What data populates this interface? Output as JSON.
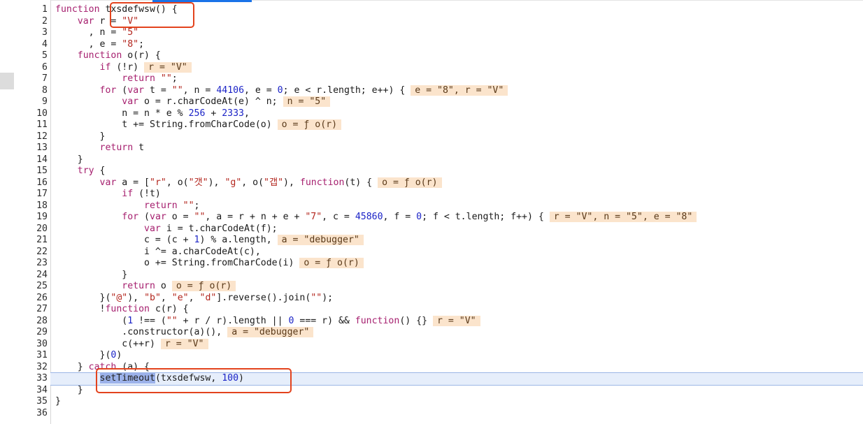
{
  "colors": {
    "keyword": "#a6206f",
    "string": "#b3261e",
    "number": "#1c24c7",
    "inline_value_bg": "#fbe4cc",
    "highlight_line": "#e6eefb",
    "annotation_red": "#e3431d"
  },
  "highlighted_line": 33,
  "lines": [
    {
      "n": "1",
      "t": [
        [
          "kw",
          "function"
        ],
        [
          "fn",
          " "
        ],
        [
          "fn",
          "txsdefwsw"
        ],
        [
          "fn",
          "() {"
        ]
      ]
    },
    {
      "n": "2",
      "t": [
        [
          "fn",
          "    "
        ],
        [
          "kw",
          "var"
        ],
        [
          "fn",
          " r = "
        ],
        [
          "str",
          "\"V\""
        ]
      ]
    },
    {
      "n": "3",
      "t": [
        [
          "fn",
          "      , n = "
        ],
        [
          "str",
          "\"5\""
        ]
      ]
    },
    {
      "n": "4",
      "t": [
        [
          "fn",
          "      , e = "
        ],
        [
          "str",
          "\"8\""
        ],
        [
          "fn",
          ";"
        ]
      ]
    },
    {
      "n": "5",
      "t": [
        [
          "fn",
          "    "
        ],
        [
          "kw",
          "function"
        ],
        [
          "fn",
          " o(r) {"
        ]
      ]
    },
    {
      "n": "6",
      "t": [
        [
          "fn",
          "        "
        ],
        [
          "kw",
          "if"
        ],
        [
          "fn",
          " (!r)"
        ]
      ],
      "p": "r = \"V\""
    },
    {
      "n": "7",
      "t": [
        [
          "fn",
          "            "
        ],
        [
          "kw",
          "return"
        ],
        [
          "fn",
          " "
        ],
        [
          "str",
          "\"\""
        ],
        [
          "fn",
          ";"
        ]
      ]
    },
    {
      "n": "8",
      "t": [
        [
          "fn",
          "        "
        ],
        [
          "kw",
          "for"
        ],
        [
          "fn",
          " ("
        ],
        [
          "kw",
          "var"
        ],
        [
          "fn",
          " t = "
        ],
        [
          "str",
          "\"\""
        ],
        [
          "fn",
          ", n = "
        ],
        [
          "num",
          "44106"
        ],
        [
          "fn",
          ", e = "
        ],
        [
          "num",
          "0"
        ],
        [
          "fn",
          "; e < r.length; e++) {"
        ]
      ],
      "p": "e = \"8\", r = \"V\""
    },
    {
      "n": "9",
      "t": [
        [
          "fn",
          "            "
        ],
        [
          "kw",
          "var"
        ],
        [
          "fn",
          " o = r.charCodeAt(e) ^ n;"
        ]
      ],
      "p": "n = \"5\""
    },
    {
      "n": "10",
      "t": [
        [
          "fn",
          "            n = n * e % "
        ],
        [
          "num",
          "256"
        ],
        [
          "fn",
          " + "
        ],
        [
          "num",
          "2333"
        ],
        [
          "fn",
          ","
        ]
      ]
    },
    {
      "n": "11",
      "t": [
        [
          "fn",
          "            t += String.fromCharCode(o)"
        ]
      ],
      "p": "o = ƒ o(r)"
    },
    {
      "n": "12",
      "t": [
        [
          "fn",
          "        }"
        ]
      ]
    },
    {
      "n": "13",
      "t": [
        [
          "fn",
          "        "
        ],
        [
          "kw",
          "return"
        ],
        [
          "fn",
          " t"
        ]
      ]
    },
    {
      "n": "14",
      "t": [
        [
          "fn",
          "    }"
        ]
      ]
    },
    {
      "n": "15",
      "t": [
        [
          "fn",
          "    "
        ],
        [
          "kw",
          "try"
        ],
        [
          "fn",
          " {"
        ]
      ]
    },
    {
      "n": "16",
      "t": [
        [
          "fn",
          "        "
        ],
        [
          "kw",
          "var"
        ],
        [
          "fn",
          " a = ["
        ],
        [
          "str",
          "\"r\""
        ],
        [
          "fn",
          ", o("
        ],
        [
          "str",
          "\"갯\""
        ],
        [
          "fn",
          "), "
        ],
        [
          "str",
          "\"g\""
        ],
        [
          "fn",
          ", o("
        ],
        [
          "str",
          "\"갭\""
        ],
        [
          "fn",
          "), "
        ],
        [
          "kw",
          "function"
        ],
        [
          "fn",
          "(t) {"
        ]
      ],
      "p": "o = ƒ o(r)"
    },
    {
      "n": "17",
      "t": [
        [
          "fn",
          "            "
        ],
        [
          "kw",
          "if"
        ],
        [
          "fn",
          " (!t)"
        ]
      ]
    },
    {
      "n": "18",
      "t": [
        [
          "fn",
          "                "
        ],
        [
          "kw",
          "return"
        ],
        [
          "fn",
          " "
        ],
        [
          "str",
          "\"\""
        ],
        [
          "fn",
          ";"
        ]
      ]
    },
    {
      "n": "19",
      "t": [
        [
          "fn",
          "            "
        ],
        [
          "kw",
          "for"
        ],
        [
          "fn",
          " ("
        ],
        [
          "kw",
          "var"
        ],
        [
          "fn",
          " o = "
        ],
        [
          "str",
          "\"\""
        ],
        [
          "fn",
          ", a = r + n + e + "
        ],
        [
          "str",
          "\"7\""
        ],
        [
          "fn",
          ", c = "
        ],
        [
          "num",
          "45860"
        ],
        [
          "fn",
          ", f = "
        ],
        [
          "num",
          "0"
        ],
        [
          "fn",
          "; f < t.length; f++) {"
        ]
      ],
      "p": "r = \"V\", n = \"5\", e = \"8\""
    },
    {
      "n": "20",
      "t": [
        [
          "fn",
          "                "
        ],
        [
          "kw",
          "var"
        ],
        [
          "fn",
          " i = t.charCodeAt(f);"
        ]
      ]
    },
    {
      "n": "21",
      "t": [
        [
          "fn",
          "                c = (c + "
        ],
        [
          "num",
          "1"
        ],
        [
          "fn",
          ") % a.length,"
        ]
      ],
      "p": "a = \"debugger\""
    },
    {
      "n": "22",
      "t": [
        [
          "fn",
          "                i ^= a.charCodeAt(c),"
        ]
      ]
    },
    {
      "n": "23",
      "t": [
        [
          "fn",
          "                o += String.fromCharCode(i)"
        ]
      ],
      "p": "o = ƒ o(r)"
    },
    {
      "n": "24",
      "t": [
        [
          "fn",
          "            }"
        ]
      ]
    },
    {
      "n": "25",
      "t": [
        [
          "fn",
          "            "
        ],
        [
          "kw",
          "return"
        ],
        [
          "fn",
          " o"
        ]
      ],
      "p": "o = ƒ o(r)"
    },
    {
      "n": "26",
      "t": [
        [
          "fn",
          "        }("
        ],
        [
          "str",
          "\"@\""
        ],
        [
          "fn",
          "), "
        ],
        [
          "str",
          "\"b\""
        ],
        [
          "fn",
          ", "
        ],
        [
          "str",
          "\"e\""
        ],
        [
          "fn",
          ", "
        ],
        [
          "str",
          "\"d\""
        ],
        [
          "fn",
          "].reverse().join("
        ],
        [
          "str",
          "\"\""
        ],
        [
          "fn",
          ");"
        ]
      ]
    },
    {
      "n": "27",
      "t": [
        [
          "fn",
          "        !"
        ],
        [
          "kw",
          "function"
        ],
        [
          "fn",
          " c(r) {"
        ]
      ]
    },
    {
      "n": "28",
      "t": [
        [
          "fn",
          "            ("
        ],
        [
          "num",
          "1"
        ],
        [
          "fn",
          " !== ("
        ],
        [
          "str",
          "\"\""
        ],
        [
          "fn",
          " + r / r).length || "
        ],
        [
          "num",
          "0"
        ],
        [
          "fn",
          " === r) && "
        ],
        [
          "kw",
          "function"
        ],
        [
          "fn",
          "() {}"
        ]
      ],
      "p": "r = \"V\""
    },
    {
      "n": "29",
      "t": [
        [
          "fn",
          "            .constructor(a)(),"
        ]
      ],
      "p": "a = \"debugger\""
    },
    {
      "n": "30",
      "t": [
        [
          "fn",
          "            c(++r)"
        ]
      ],
      "p": "r = \"V\""
    },
    {
      "n": "31",
      "t": [
        [
          "fn",
          "        }("
        ],
        [
          "num",
          "0"
        ],
        [
          "fn",
          ")"
        ]
      ]
    },
    {
      "n": "32",
      "t": [
        [
          "fn",
          "    } "
        ],
        [
          "kw",
          "catch"
        ],
        [
          "fn",
          " (a) {"
        ]
      ]
    },
    {
      "n": "33",
      "t": [
        [
          "fn",
          "        "
        ],
        [
          "sel",
          "setTimeout"
        ],
        [
          "fn",
          "(txsdefwsw, "
        ],
        [
          "num",
          "100"
        ],
        [
          "fn",
          ")"
        ]
      ]
    },
    {
      "n": "34",
      "t": [
        [
          "fn",
          "    }"
        ]
      ]
    },
    {
      "n": "35",
      "t": [
        [
          "fn",
          "}"
        ]
      ]
    },
    {
      "n": "36",
      "t": [
        [
          "fn",
          ""
        ]
      ]
    }
  ]
}
